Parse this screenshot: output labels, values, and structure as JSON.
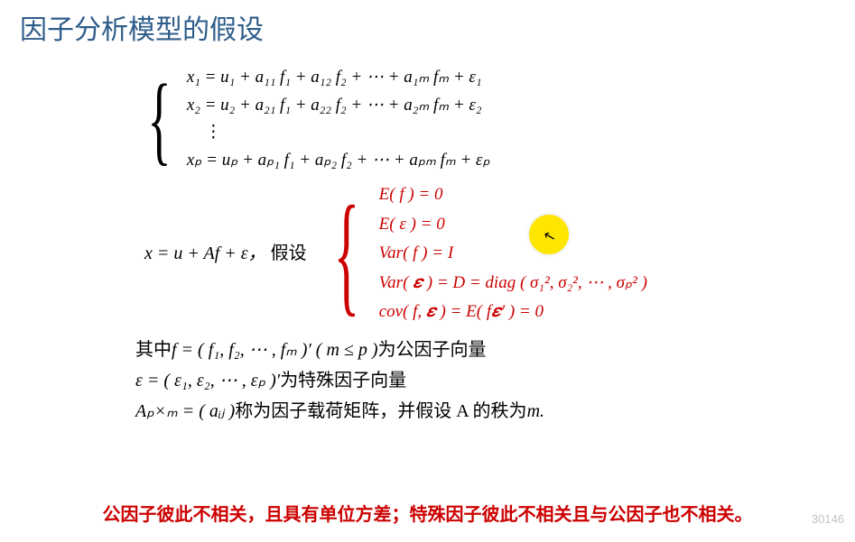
{
  "title": "因子分析模型的假设",
  "system": {
    "eq1": "x₁ = u₁ + a₁₁ f₁ + a₁₂ f₂ + ⋯ + a₁ₘ fₘ + ε₁",
    "eq2": "x₂ = u₂ + a₂₁ f₁ + a₂₂ f₂ + ⋯ + a₂ₘ fₘ + ε₂",
    "dots": "⋮",
    "eqp": "xₚ = uₚ + aₚ₁ f₁ + aₚ₂ f₂ + ⋯ + aₚₘ fₘ + εₚ"
  },
  "compact": {
    "lhs": "x = u + Af + ε，",
    "label": "假设"
  },
  "assumptions": {
    "a1": "E( f ) = 0",
    "a2": "E( ε ) = 0",
    "a3": "Var( f ) = I",
    "a4": "Var( 𝜺 ) = D = diag ( σ₁², σ₂², ⋯ , σₚ² )",
    "a5": "cov( f, 𝜺 ) = E( f𝜺′ ) = 0"
  },
  "desc": {
    "line1a": "其中",
    "line1b": "f = ( f₁, f₂, ⋯ , fₘ )′ ( m ≤ p )",
    "line1c": "为公因子向量",
    "line2a": "ε = ( ε₁, ε₂, ⋯ , εₚ )′",
    "line2b": "为特殊因子向量",
    "line3a": "Aₚ×ₘ = ( aᵢⱼ )",
    "line3b": "称为因子载荷矩阵，并假设 A 的秩为",
    "line3c": "m."
  },
  "bottom": "公因子彼此不相关，且具有单位方差；特殊因子彼此不相关且与公因子也不相关。",
  "watermark": "30146"
}
